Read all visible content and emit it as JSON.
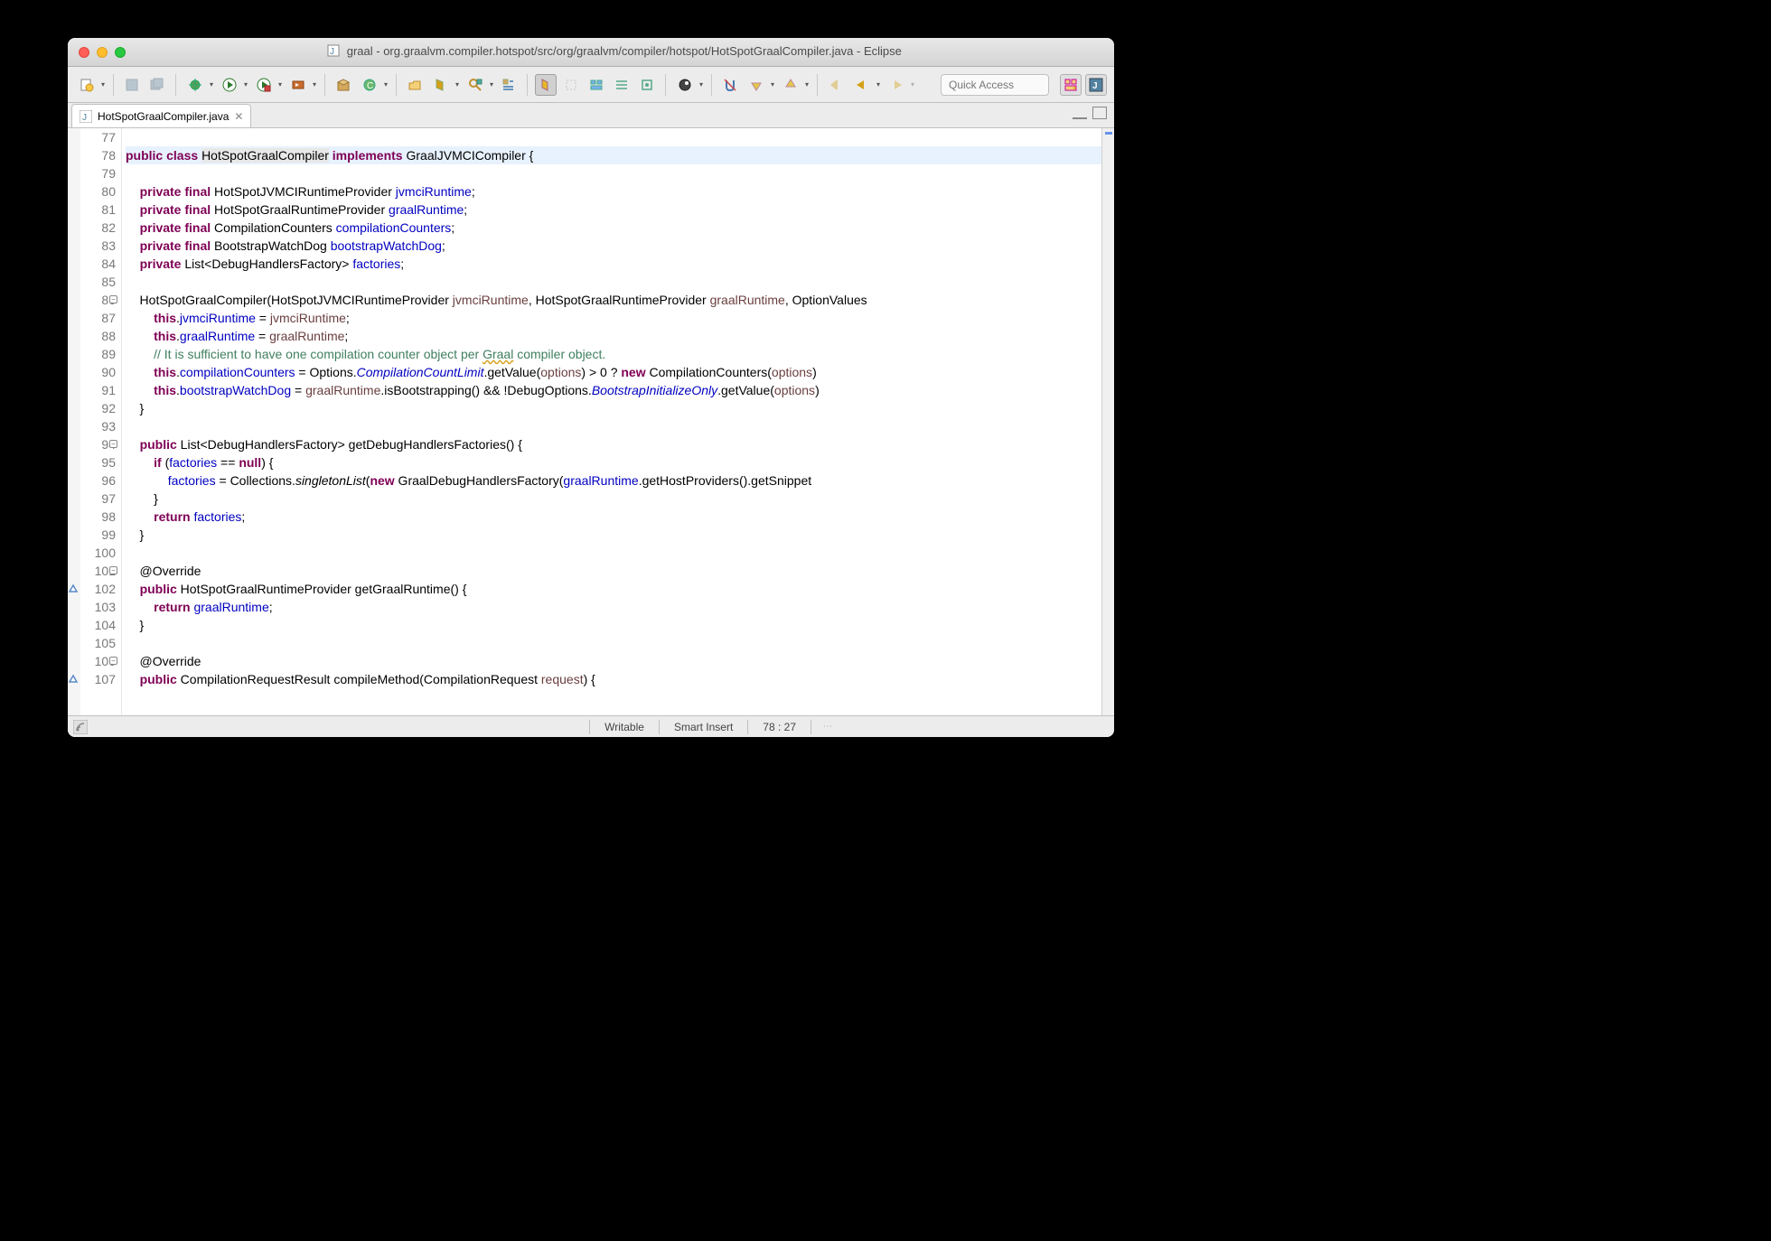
{
  "window": {
    "title": "graal - org.graalvm.compiler.hotspot/src/org/graalvm/compiler/hotspot/HotSpotGraalCompiler.java - Eclipse"
  },
  "toolbar": {
    "quick_access_placeholder": "Quick Access"
  },
  "tab": {
    "label": "HotSpotGraalCompiler.java"
  },
  "editor": {
    "first_line_number": 77,
    "highlighted_line": 78,
    "fold_markers": [
      86,
      94,
      101,
      106
    ],
    "override_markers": [
      102,
      107
    ],
    "lines": [
      {
        "n": 77,
        "raw": " */",
        "hidden_top": true
      },
      {
        "n": 78,
        "tokens": [
          [
            "kw",
            "public"
          ],
          [
            "",
            " "
          ],
          [
            "kw",
            "class"
          ],
          [
            "",
            " "
          ],
          [
            "cls-name",
            "HotSpotGraalCompiler"
          ],
          [
            "",
            " "
          ],
          [
            "kw",
            "implements"
          ],
          [
            "",
            " GraalJVMCICompiler {"
          ]
        ]
      },
      {
        "n": 79,
        "tokens": [
          [
            "",
            ""
          ]
        ]
      },
      {
        "n": 80,
        "tokens": [
          [
            "",
            "    "
          ],
          [
            "kw",
            "private"
          ],
          [
            "",
            " "
          ],
          [
            "kw",
            "final"
          ],
          [
            "",
            " HotSpotJVMCIRuntimeProvider "
          ],
          [
            "field",
            "jvmciRuntime"
          ],
          [
            "",
            ";"
          ]
        ]
      },
      {
        "n": 81,
        "tokens": [
          [
            "",
            "    "
          ],
          [
            "kw",
            "private"
          ],
          [
            "",
            " "
          ],
          [
            "kw",
            "final"
          ],
          [
            "",
            " HotSpotGraalRuntimeProvider "
          ],
          [
            "field",
            "graalRuntime"
          ],
          [
            "",
            ";"
          ]
        ]
      },
      {
        "n": 82,
        "tokens": [
          [
            "",
            "    "
          ],
          [
            "kw",
            "private"
          ],
          [
            "",
            " "
          ],
          [
            "kw",
            "final"
          ],
          [
            "",
            " CompilationCounters "
          ],
          [
            "field",
            "compilationCounters"
          ],
          [
            "",
            ";"
          ]
        ]
      },
      {
        "n": 83,
        "tokens": [
          [
            "",
            "    "
          ],
          [
            "kw",
            "private"
          ],
          [
            "",
            " "
          ],
          [
            "kw",
            "final"
          ],
          [
            "",
            " BootstrapWatchDog "
          ],
          [
            "field",
            "bootstrapWatchDog"
          ],
          [
            "",
            ";"
          ]
        ]
      },
      {
        "n": 84,
        "tokens": [
          [
            "",
            "    "
          ],
          [
            "kw",
            "private"
          ],
          [
            "",
            " List<DebugHandlersFactory> "
          ],
          [
            "field",
            "factories"
          ],
          [
            "",
            ";"
          ]
        ]
      },
      {
        "n": 85,
        "tokens": [
          [
            "",
            ""
          ]
        ]
      },
      {
        "n": 86,
        "tokens": [
          [
            "",
            "    HotSpotGraalCompiler(HotSpotJVMCIRuntimeProvider "
          ],
          [
            "param",
            "jvmciRuntime"
          ],
          [
            "",
            ", HotSpotGraalRuntimeProvider "
          ],
          [
            "param",
            "graalRuntime"
          ],
          [
            "",
            ", OptionValues"
          ]
        ]
      },
      {
        "n": 87,
        "tokens": [
          [
            "",
            "        "
          ],
          [
            "kw",
            "this"
          ],
          [
            "",
            "."
          ],
          [
            "field",
            "jvmciRuntime"
          ],
          [
            "",
            " = "
          ],
          [
            "param",
            "jvmciRuntime"
          ],
          [
            "",
            ";"
          ]
        ]
      },
      {
        "n": 88,
        "tokens": [
          [
            "",
            "        "
          ],
          [
            "kw",
            "this"
          ],
          [
            "",
            "."
          ],
          [
            "field",
            "graalRuntime"
          ],
          [
            "",
            " = "
          ],
          [
            "param",
            "graalRuntime"
          ],
          [
            "",
            ";"
          ]
        ]
      },
      {
        "n": 89,
        "tokens": [
          [
            "",
            "        "
          ],
          [
            "comment",
            "// It is sufficient to have one compilation counter object per "
          ],
          [
            "comment warn",
            "Graal"
          ],
          [
            "comment",
            " compiler object."
          ]
        ]
      },
      {
        "n": 90,
        "tokens": [
          [
            "",
            "        "
          ],
          [
            "kw",
            "this"
          ],
          [
            "",
            "."
          ],
          [
            "field",
            "compilationCounters"
          ],
          [
            "",
            " = Options."
          ],
          [
            "str-it",
            "CompilationCountLimit"
          ],
          [
            "",
            ".getValue("
          ],
          [
            "param",
            "options"
          ],
          [
            "",
            ") > 0 ? "
          ],
          [
            "kw",
            "new"
          ],
          [
            "",
            " CompilationCounters("
          ],
          [
            "param",
            "options"
          ],
          [
            "",
            ")"
          ]
        ]
      },
      {
        "n": 91,
        "tokens": [
          [
            "",
            "        "
          ],
          [
            "kw",
            "this"
          ],
          [
            "",
            "."
          ],
          [
            "field",
            "bootstrapWatchDog"
          ],
          [
            "",
            " = "
          ],
          [
            "param",
            "graalRuntime"
          ],
          [
            "",
            ".isBootstrapping() && !DebugOptions."
          ],
          [
            "str-it",
            "BootstrapInitializeOnly"
          ],
          [
            "",
            ".getValue("
          ],
          [
            "param",
            "options"
          ],
          [
            "",
            ")"
          ]
        ]
      },
      {
        "n": 92,
        "tokens": [
          [
            "",
            "    }"
          ]
        ]
      },
      {
        "n": 93,
        "tokens": [
          [
            "",
            ""
          ]
        ]
      },
      {
        "n": 94,
        "tokens": [
          [
            "",
            "    "
          ],
          [
            "kw",
            "public"
          ],
          [
            "",
            " List<DebugHandlersFactory> getDebugHandlersFactories() {"
          ]
        ]
      },
      {
        "n": 95,
        "tokens": [
          [
            "",
            "        "
          ],
          [
            "kw",
            "if"
          ],
          [
            "",
            " ("
          ],
          [
            "field",
            "factories"
          ],
          [
            "",
            " == "
          ],
          [
            "kw",
            "null"
          ],
          [
            "",
            ") {"
          ]
        ]
      },
      {
        "n": 96,
        "tokens": [
          [
            "",
            "            "
          ],
          [
            "field",
            "factories"
          ],
          [
            "",
            " = Collections."
          ],
          [
            "method-it",
            "singletonList"
          ],
          [
            "",
            "("
          ],
          [
            "kw",
            "new"
          ],
          [
            "",
            " GraalDebugHandlersFactory("
          ],
          [
            "field",
            "graalRuntime"
          ],
          [
            "",
            ".getHostProviders().getSnippet"
          ]
        ]
      },
      {
        "n": 97,
        "tokens": [
          [
            "",
            "        }"
          ]
        ]
      },
      {
        "n": 98,
        "tokens": [
          [
            "",
            "        "
          ],
          [
            "kw",
            "return"
          ],
          [
            "",
            " "
          ],
          [
            "field",
            "factories"
          ],
          [
            "",
            ";"
          ]
        ]
      },
      {
        "n": 99,
        "tokens": [
          [
            "",
            "    }"
          ]
        ]
      },
      {
        "n": 100,
        "tokens": [
          [
            "",
            ""
          ]
        ]
      },
      {
        "n": 101,
        "tokens": [
          [
            "",
            "    @Override"
          ]
        ]
      },
      {
        "n": 102,
        "tokens": [
          [
            "",
            "    "
          ],
          [
            "kw",
            "public"
          ],
          [
            "",
            " HotSpotGraalRuntimeProvider getGraalRuntime() {"
          ]
        ]
      },
      {
        "n": 103,
        "tokens": [
          [
            "",
            "        "
          ],
          [
            "kw",
            "return"
          ],
          [
            "",
            " "
          ],
          [
            "field",
            "graalRuntime"
          ],
          [
            "",
            ";"
          ]
        ]
      },
      {
        "n": 104,
        "tokens": [
          [
            "",
            "    }"
          ]
        ]
      },
      {
        "n": 105,
        "tokens": [
          [
            "",
            ""
          ]
        ]
      },
      {
        "n": 106,
        "tokens": [
          [
            "",
            "    @Override"
          ]
        ]
      },
      {
        "n": 107,
        "tokens": [
          [
            "",
            "    "
          ],
          [
            "kw",
            "public"
          ],
          [
            "",
            " CompilationRequestResult compileMethod(CompilationRequest "
          ],
          [
            "param",
            "request"
          ],
          [
            "",
            ") {"
          ]
        ]
      }
    ]
  },
  "statusbar": {
    "writable": "Writable",
    "insert_mode": "Smart Insert",
    "cursor": "78 : 27"
  }
}
